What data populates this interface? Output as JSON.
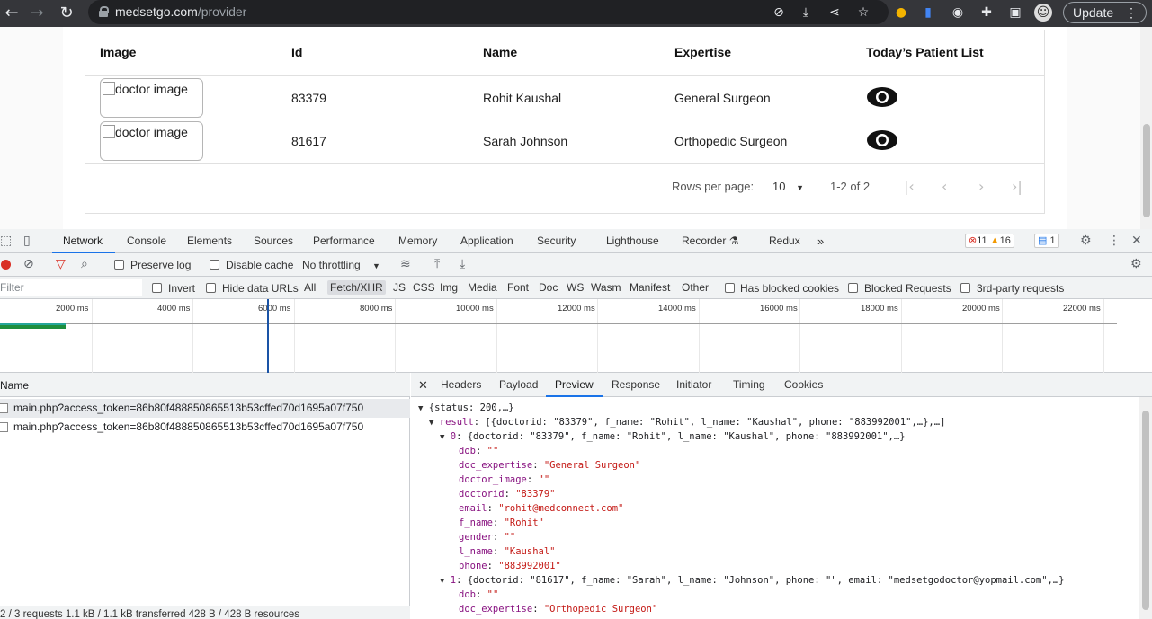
{
  "browser": {
    "url_host": "medsetgo.com",
    "url_path": "/provider",
    "update_label": "Update"
  },
  "table": {
    "headers": [
      "Image",
      "Id",
      "Name",
      "Expertise",
      "Today’s Patient List"
    ],
    "rows": [
      {
        "image_alt": "doctor image",
        "id": "83379",
        "name": "Rohit Kaushal",
        "expertise": "General Surgeon"
      },
      {
        "image_alt": "doctor image",
        "id": "81617",
        "name": "Sarah Johnson",
        "expertise": "Orthopedic Surgeon"
      }
    ],
    "rows_per_page_label": "Rows per page:",
    "rows_per_page_value": "10",
    "range_label": "1-2 of 2"
  },
  "devtools": {
    "tabs": [
      "Network",
      "Console",
      "Elements",
      "Sources",
      "Performance",
      "Memory",
      "Application",
      "Security",
      "Lighthouse",
      "Recorder",
      "Redux"
    ],
    "errors": "11",
    "warnings": "16",
    "messages": "1",
    "preserve_log": "Preserve log",
    "disable_cache": "Disable cache",
    "throttling": "No throttling",
    "filter_placeholder": "Filter",
    "invert": "Invert",
    "hide_data_urls": "Hide data URLs",
    "types": [
      "All",
      "Fetch/XHR",
      "JS",
      "CSS",
      "Img",
      "Media",
      "Font",
      "Doc",
      "WS",
      "Wasm",
      "Manifest",
      "Other"
    ],
    "has_blocked_cookies": "Has blocked cookies",
    "blocked_requests": "Blocked Requests",
    "third_party": "3rd-party requests",
    "timeline_ticks": [
      "2000 ms",
      "4000 ms",
      "6000 ms",
      "8000 ms",
      "10000 ms",
      "12000 ms",
      "14000 ms",
      "16000 ms",
      "18000 ms",
      "20000 ms",
      "22000 ms"
    ],
    "name_header": "Name",
    "requests": [
      "main.php?access_token=86b80f488850865513b53cffed70d1695a07f750",
      "main.php?access_token=86b80f488850865513b53cffed70d1695a07f750"
    ],
    "status_bar": "2 / 3 requests   1.1 kB / 1.1 kB transferred   428 B / 428 B resources",
    "detail_tabs": [
      "Headers",
      "Payload",
      "Preview",
      "Response",
      "Initiator",
      "Timing",
      "Cookies"
    ],
    "preview": {
      "line0": "{status: 200,…}",
      "result_summary": "[{doctorid: \"83379\", f_name: \"Rohit\", l_name: \"Kaushal\", phone: \"883992001\",…},…]",
      "item0_summary": "{doctorid: \"83379\", f_name: \"Rohit\", l_name: \"Kaushal\", phone: \"883992001\",…}",
      "item0": {
        "dob": "\"\"",
        "doc_expertise": "\"General Surgeon\"",
        "doctor_image": "\"\"",
        "doctorid": "\"83379\"",
        "email": "\"rohit@medconnect.com\"",
        "f_name": "\"Rohit\"",
        "gender": "\"\"",
        "l_name": "\"Kaushal\"",
        "phone": "\"883992001\""
      },
      "item1_summary": "{doctorid: \"81617\", f_name: \"Sarah\", l_name: \"Johnson\", phone: \"\", email: \"medsetgodoctor@yopmail.com\",…}",
      "item1": {
        "dob": "\"\"",
        "doc_expertise": "\"Orthopedic Surgeon\""
      }
    }
  }
}
